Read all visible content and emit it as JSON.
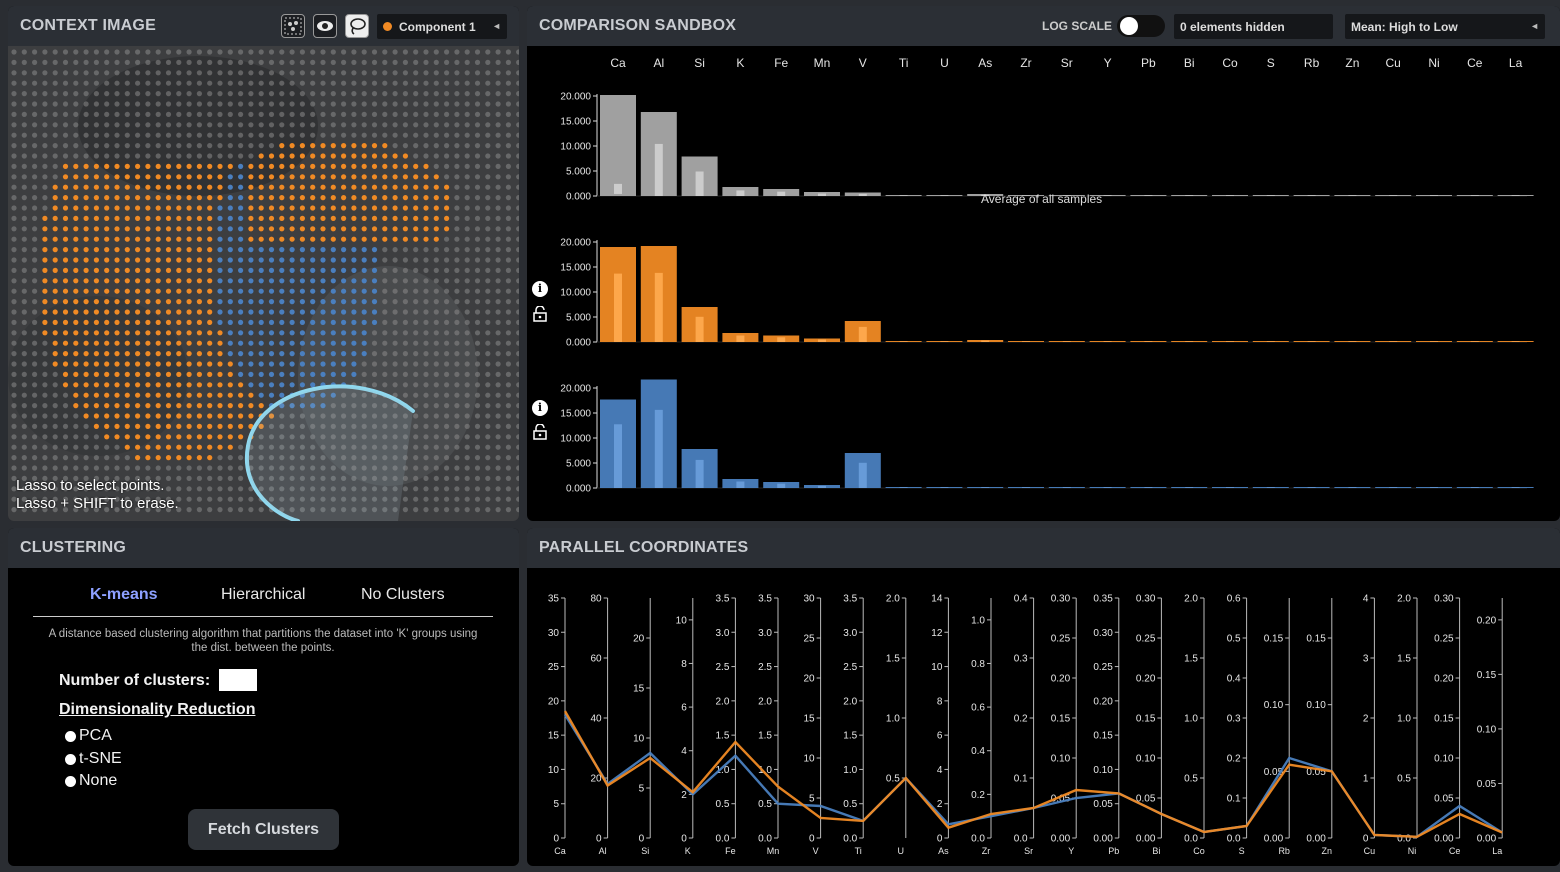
{
  "context": {
    "title": "CONTEXT IMAGE",
    "component_label": "Component 1",
    "component_color": "#f08a24",
    "hint_line1": "Lasso to select points.",
    "hint_line2": "Lasso + SHIFT to erase."
  },
  "sandbox": {
    "title": "COMPARISON SANDBOX",
    "log_scale_label": "LOG SCALE",
    "hidden_text": "0 elements hidden",
    "sort_label": "Mean: High to Low",
    "average_label": "Average of all samples"
  },
  "clustering": {
    "title": "CLUSTERING",
    "tabs": [
      "K-means",
      "Hierarchical",
      "No Clusters"
    ],
    "description": "A distance based clustering algorithm that partitions the dataset into 'K' groups using the dist. between the points.",
    "num_clusters_label": "Number of clusters:",
    "dim_reduction_label": "Dimensionality Reduction",
    "options": [
      "PCA",
      "t-SNE",
      "None"
    ],
    "fetch_label": "Fetch Clusters"
  },
  "parallel": {
    "title": "PARALLEL COORDINATES"
  },
  "colors": {
    "gray": "#a9a9a9",
    "orange": "#f08a24",
    "blue": "#4a7fbf",
    "lasso": "#8fd9f0"
  },
  "chart_data": [
    {
      "type": "bar",
      "categories": [
        "Ca",
        "Al",
        "Si",
        "K",
        "Fe",
        "Mn",
        "V",
        "Ti",
        "U",
        "As",
        "Zr",
        "Sr",
        "Y",
        "Pb",
        "Bi",
        "Co",
        "S",
        "Rb",
        "Zn",
        "Cu",
        "Ni",
        "Ce",
        "La"
      ],
      "yticks": [
        "0.000",
        "5.000",
        "10.000",
        "15.000",
        "20.000"
      ],
      "ylim": [
        0,
        20000
      ],
      "series": [
        {
          "name": "Average of all samples",
          "values": [
            20200,
            16800,
            7900,
            1800,
            1400,
            800,
            700,
            200,
            150,
            400,
            80,
            60,
            40,
            30,
            20,
            20,
            15,
            10,
            10,
            5,
            5,
            5,
            5
          ]
        },
        {
          "values": [
            19000,
            19200,
            7000,
            1800,
            1300,
            700,
            4200,
            200,
            150,
            400,
            80,
            60,
            40,
            30,
            20,
            20,
            15,
            10,
            10,
            5,
            5,
            5,
            5
          ]
        },
        {
          "values": [
            17700,
            21700,
            7800,
            1800,
            1200,
            600,
            7000,
            150,
            150,
            200,
            80,
            60,
            40,
            30,
            20,
            20,
            15,
            10,
            10,
            5,
            5,
            5,
            5
          ]
        }
      ]
    },
    {
      "type": "line",
      "axes": [
        {
          "name": "Ca",
          "ticks": [
            "0",
            "5",
            "10",
            "15",
            "20",
            "25",
            "30",
            "35"
          ],
          "max": 35
        },
        {
          "name": "Al",
          "ticks": [
            "0",
            "20",
            "40",
            "60",
            "80"
          ],
          "max": 80
        },
        {
          "name": "Si",
          "ticks": [
            "0",
            "5",
            "10",
            "15",
            "20"
          ],
          "max": 24
        },
        {
          "name": "K",
          "ticks": [
            "0",
            "2",
            "4",
            "6",
            "8",
            "10"
          ],
          "max": 11
        },
        {
          "name": "Fe",
          "ticks": [
            "0.0",
            "0.5",
            "1.0",
            "1.5",
            "2.0",
            "2.5",
            "3.0",
            "3.5"
          ],
          "max": 3.5
        },
        {
          "name": "Mn",
          "ticks": [
            "0.0",
            "0.5",
            "1.0",
            "1.5",
            "2.0",
            "2.5",
            "3.0",
            "3.5"
          ],
          "max": 3.5
        },
        {
          "name": "V",
          "ticks": [
            "0",
            "5",
            "10",
            "15",
            "20",
            "25",
            "30"
          ],
          "max": 30
        },
        {
          "name": "Ti",
          "ticks": [
            "0.0",
            "0.5",
            "1.0",
            "1.5",
            "2.0",
            "2.5",
            "3.0",
            "3.5"
          ],
          "max": 3.5
        },
        {
          "name": "U",
          "ticks": [
            "0.5",
            "1.0",
            "1.5",
            "2.0"
          ],
          "max": 2.0
        },
        {
          "name": "As",
          "ticks": [
            "0",
            "2",
            "4",
            "6",
            "8",
            "10",
            "12",
            "14"
          ],
          "max": 14
        },
        {
          "name": "Zr",
          "ticks": [
            "0.0",
            "0.2",
            "0.4",
            "0.6",
            "0.8",
            "1.0"
          ],
          "max": 1.1
        },
        {
          "name": "Sr",
          "ticks": [
            "0.0",
            "0.1",
            "0.2",
            "0.3",
            "0.4"
          ],
          "max": 0.4
        },
        {
          "name": "Y",
          "ticks": [
            "0.00",
            "0.05",
            "0.10",
            "0.15",
            "0.20",
            "0.25",
            "0.30"
          ],
          "max": 0.3
        },
        {
          "name": "Pb",
          "ticks": [
            "0.00",
            "0.05",
            "0.10",
            "0.15",
            "0.20",
            "0.25",
            "0.30",
            "0.35"
          ],
          "max": 0.35
        },
        {
          "name": "Bi",
          "ticks": [
            "0.00",
            "0.05",
            "0.10",
            "0.15",
            "0.20",
            "0.25",
            "0.30"
          ],
          "max": 0.3
        },
        {
          "name": "Co",
          "ticks": [
            "0.0",
            "0.5",
            "1.0",
            "1.5",
            "2.0"
          ],
          "max": 2.0
        },
        {
          "name": "S",
          "ticks": [
            "0.0",
            "0.1",
            "0.2",
            "0.3",
            "0.4",
            "0.5",
            "0.6"
          ],
          "max": 0.6
        },
        {
          "name": "Rb",
          "ticks": [
            "0.00",
            "0.05",
            "0.10",
            "0.15"
          ],
          "max": 0.18
        },
        {
          "name": "Zn",
          "ticks": [
            "0.00",
            "0.05",
            "0.10",
            "0.15"
          ],
          "max": 0.18
        },
        {
          "name": "Cu",
          "ticks": [
            "0",
            "1",
            "2",
            "3",
            "4"
          ],
          "max": 4
        },
        {
          "name": "Ni",
          "ticks": [
            "0.0",
            "0.5",
            "1.0",
            "1.5",
            "2.0"
          ],
          "max": 2.0
        },
        {
          "name": "Ce",
          "ticks": [
            "0.00",
            "0.05",
            "0.10",
            "0.15",
            "0.20",
            "0.25",
            "0.30"
          ],
          "max": 0.3
        },
        {
          "name": "La",
          "ticks": [
            "0.00",
            "0.05",
            "0.10",
            "0.15",
            "0.20"
          ],
          "max": 0.22
        }
      ],
      "series": [
        {
          "values": [
            18.0,
            18,
            8.5,
            2,
            1.2,
            0.5,
            4,
            0.25,
            0.5,
            0.8,
            0.1,
            0.05,
            0.05,
            0.065,
            0.03,
            0.05,
            0.03,
            0.06,
            0.05,
            0.05,
            0.01,
            0.04,
            0.005
          ]
        },
        {
          "values": [
            18.5,
            17.5,
            8,
            2.1,
            1.4,
            0.75,
            2.5,
            0.25,
            0.5,
            0.6,
            0.11,
            0.05,
            0.06,
            0.065,
            0.03,
            0.05,
            0.03,
            0.055,
            0.05,
            0.05,
            0.01,
            0.03,
            0.005
          ]
        }
      ]
    }
  ]
}
